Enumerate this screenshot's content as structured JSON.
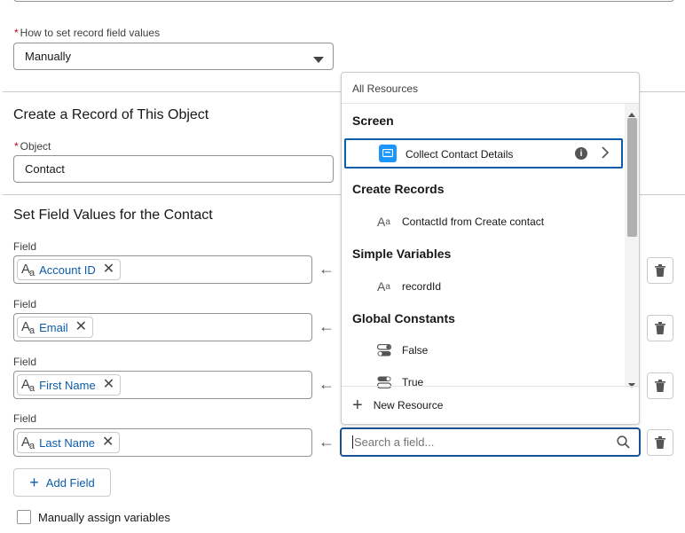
{
  "how_to_set": {
    "label": "How to set record field values",
    "required_mark": "*",
    "value": "Manually"
  },
  "create_record": {
    "title": "Create a Record of This Object",
    "object_label": "Object",
    "required_mark": "*",
    "object_value": "Contact"
  },
  "set_field_values": {
    "title": "Set Field Values for the Contact",
    "rows": [
      {
        "label": "Field",
        "value": "Account ID"
      },
      {
        "label": "Field",
        "value": "Email"
      },
      {
        "label": "Field",
        "value": "First Name"
      },
      {
        "label": "Field",
        "value": "Last Name"
      }
    ],
    "add_field_label": "Add Field",
    "manual_assign_label": "Manually assign variables"
  },
  "dropdown": {
    "header": "All Resources",
    "groups": [
      {
        "name": "Screen",
        "items": [
          {
            "label": "Collect Contact Details",
            "icon": "screen-icon"
          }
        ]
      },
      {
        "name": "Create Records",
        "items": [
          {
            "label": "ContactId from Create contact",
            "icon": "text-type-icon"
          }
        ]
      },
      {
        "name": "Simple Variables",
        "items": [
          {
            "label": "recordId",
            "icon": "text-type-icon"
          }
        ]
      },
      {
        "name": "Global Constants",
        "items": [
          {
            "label": "False",
            "icon": "toggle-icon"
          },
          {
            "label": "True",
            "icon": "toggle-icon"
          }
        ]
      }
    ],
    "new_resource_label": "New Resource"
  },
  "search": {
    "placeholder": "Search a field..."
  },
  "colors": {
    "accent": "#0b5cab",
    "screen_icon": "#1b96ff",
    "required": "#ba0517"
  }
}
